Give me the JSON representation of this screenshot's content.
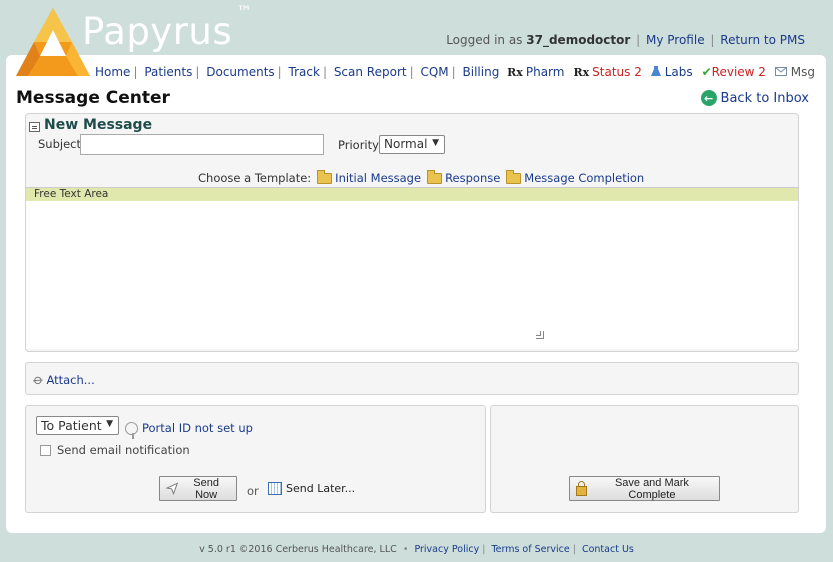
{
  "header": {
    "brand": "Papyrus",
    "trademark": "™",
    "logged_in_prefix": "Logged in as",
    "username": "37_demodoctor",
    "my_profile": "My Profile",
    "return_pms": "Return to PMS"
  },
  "nav": {
    "items": [
      "Home",
      "Patients",
      "Documents",
      "Track",
      "Scan Report",
      "CQM",
      "Billing"
    ],
    "right": {
      "rx_symbol": "Rx",
      "pharm": "Pharm",
      "status": "Status 2",
      "labs": "Labs",
      "review": "Review 2",
      "msg": "Msg"
    }
  },
  "page": {
    "title": "Message Center",
    "back_to_inbox": "Back to Inbox"
  },
  "compose": {
    "title": "New Message",
    "subject_label": "Subject",
    "subject_value": "",
    "priority_label": "Priority",
    "priority_value": "Normal",
    "choose_template": "Choose a Template:",
    "templates": [
      "Initial Message",
      "Response",
      "Message Completion"
    ],
    "free_text_label": "Free Text Area",
    "free_text_value": ""
  },
  "attach": {
    "label": "Attach..."
  },
  "send": {
    "recipient": "To Patient",
    "portal_status": "Portal ID not set up",
    "email_notification": "Send email notification",
    "send_now": "Send Now",
    "or": "or",
    "send_later": "Send Later..."
  },
  "complete": {
    "save_label": "Save and Mark Complete"
  },
  "footer": {
    "version": "v 5.0 r1 ©2016 Cerberus Healthcare, LLC",
    "bullet": "•",
    "privacy": "Privacy Policy",
    "terms": "Terms of Service",
    "contact": "Contact Us"
  },
  "colors": {
    "background": "#cddedb",
    "link": "#1a3a8a",
    "alert": "#cc2222",
    "title_teal": "#1f4d4a",
    "free_text_header": "#e0e8ad"
  }
}
